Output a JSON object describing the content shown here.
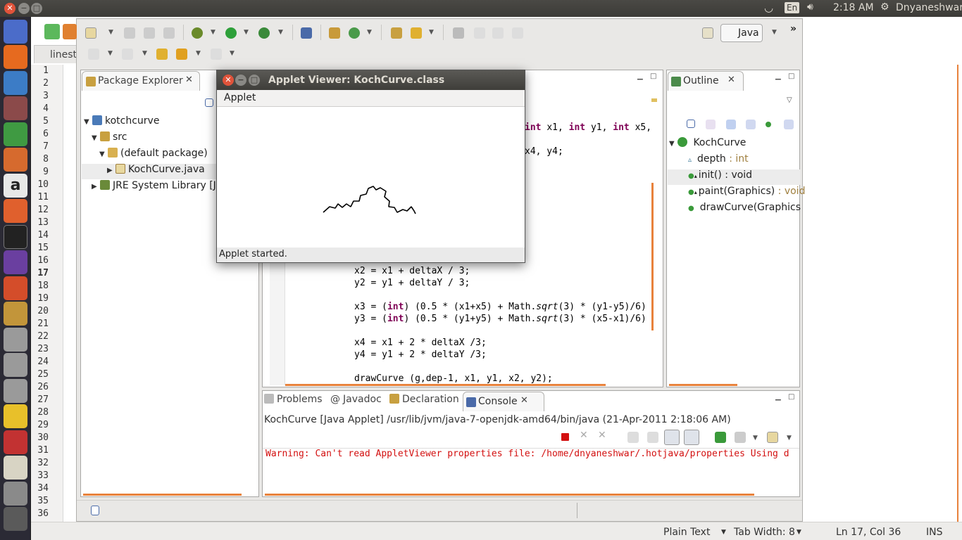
{
  "top_panel": {
    "keyboard": "En",
    "time": "2:18 AM",
    "user": "Dnyaneshwar"
  },
  "gedit": {
    "tab_label": "linest",
    "line_numbers": [
      "1",
      "2",
      "3",
      "4",
      "5",
      "6",
      "7",
      "8",
      "9",
      "10",
      "11",
      "12",
      "13",
      "14",
      "15",
      "16",
      "17",
      "18",
      "19",
      "20",
      "21",
      "22",
      "23",
      "24",
      "25",
      "26",
      "27",
      "28",
      "29",
      "30",
      "31",
      "32",
      "33",
      "34",
      "35",
      "36"
    ],
    "current_line": "17",
    "status": {
      "language": "Plain Text",
      "tab_width": "Tab Width: 8",
      "position": "Ln 17, Col 36",
      "mode": "INS"
    }
  },
  "eclipse": {
    "perspective": "Java",
    "package_explorer": {
      "title": "Package Explorer",
      "items": [
        {
          "label": "kotchcurve"
        },
        {
          "label": "src"
        },
        {
          "label": "(default package)"
        },
        {
          "label": "KochCurve.java"
        },
        {
          "label": "JRE System Library [Ja"
        }
      ]
    },
    "editor": {
      "visible_top_1": "int",
      "visible_top_2": "x1,",
      "visible_top_3": "int",
      "visible_top_4": "y1,",
      "visible_top_5": "int",
      "visible_top_6": "x5,",
      "visible_top_7": "x4, y4;",
      "lines": {
        "l1": "x2 = x1 + deltaX / 3;",
        "l2": "y2 = y1 + deltaY / 3;",
        "l3a": "x3 = (",
        "l3b": "int",
        "l3c": ") (0.5 * (x1+x5) + Math.",
        "l3d": "sqrt",
        "l3e": "(3) * (y1-y5)/6)",
        "l4a": "y3 = (",
        "l4b": "int",
        "l4c": ") (0.5 * (y1+y5) + Math.",
        "l4d": "sqrt",
        "l4e": "(3) * (x5-x1)/6)",
        "l5": "x4 = x1 + 2 * deltaX /3;",
        "l6": "y4 = y1 + 2 * deltaY /3;",
        "l7": "drawCurve (g,dep-1, x1, y1, x2, y2);"
      }
    },
    "outline": {
      "title": "Outline",
      "class": "KochCurve",
      "members": [
        {
          "name": "depth",
          "type": " : int"
        },
        {
          "name": "init()",
          "type": " : void"
        },
        {
          "name": "paint(Graphics)",
          "type": " : void"
        },
        {
          "name": "drawCurve(Graphics",
          "type": ""
        }
      ]
    },
    "bottom_tabs": {
      "problems": "Problems",
      "javadoc": "Javadoc",
      "declaration": "Declaration",
      "console": "Console"
    },
    "console": {
      "header": "KochCurve [Java Applet] /usr/lib/jvm/java-7-openjdk-amd64/bin/java (21-Apr-2011 2:18:06 AM)",
      "output": "Warning: Can't read AppletViewer properties file: /home/dnyaneshwar/.hotjava/properties Using d"
    }
  },
  "applet": {
    "title": "Applet Viewer: KochCurve.class",
    "menu": "Applet",
    "status": "Applet started."
  },
  "colors": {
    "accent_orange": "#e8823c",
    "keyword": "#7f0055",
    "console_error": "#d31010"
  }
}
